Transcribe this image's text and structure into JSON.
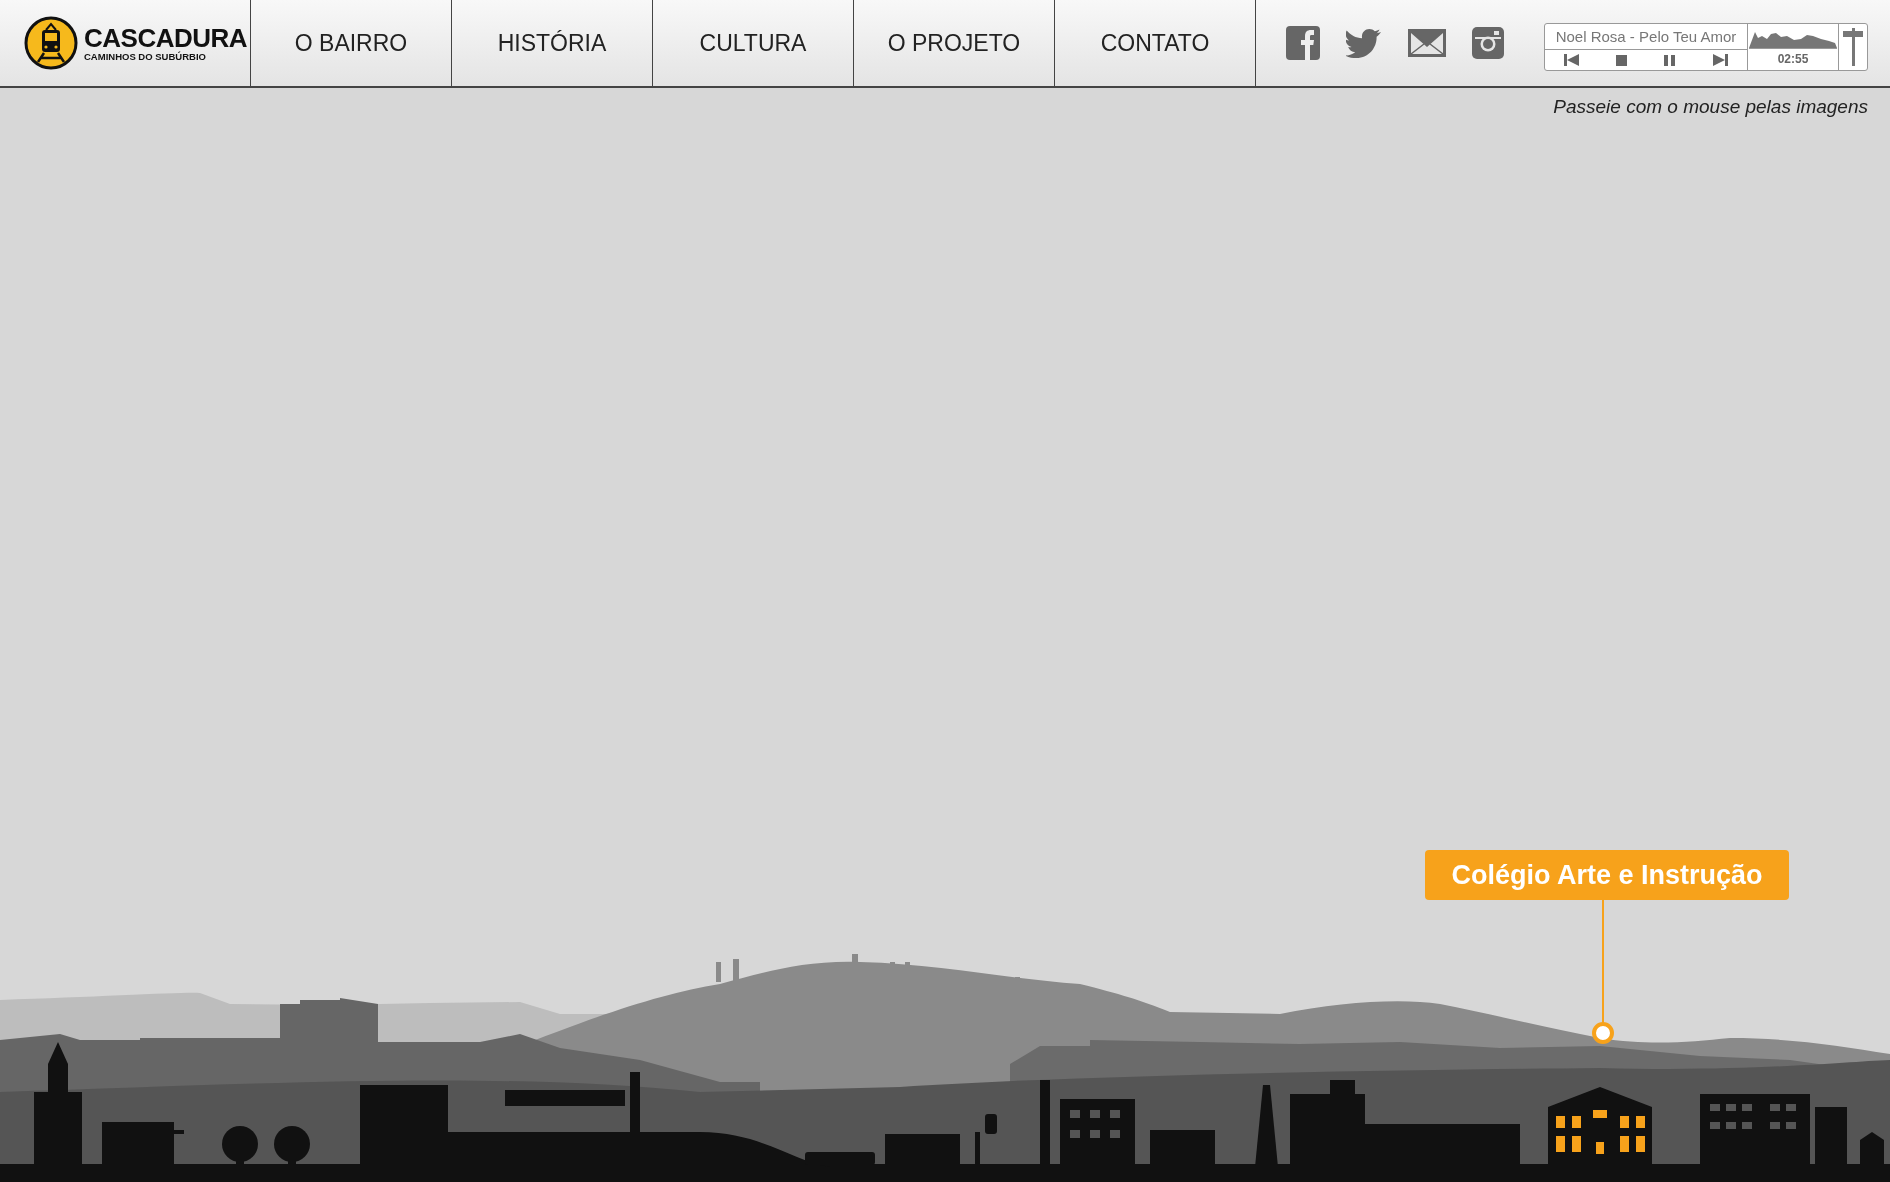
{
  "logo": {
    "title": "CASCADURA",
    "subtitle": "CAMINHOS DO SUBÚRBIO"
  },
  "nav": [
    "O BAIRRO",
    "HISTÓRIA",
    "CULTURA",
    "O PROJETO",
    "CONTATO"
  ],
  "player": {
    "track": "Noel Rosa - Pelo Teu Amor",
    "time": "02:55",
    "volume": {
      "level": 0.85
    }
  },
  "hint": "Passeie com o mouse pelas imagens",
  "tooltip": {
    "label": "Colégio Arte e Instrução"
  }
}
